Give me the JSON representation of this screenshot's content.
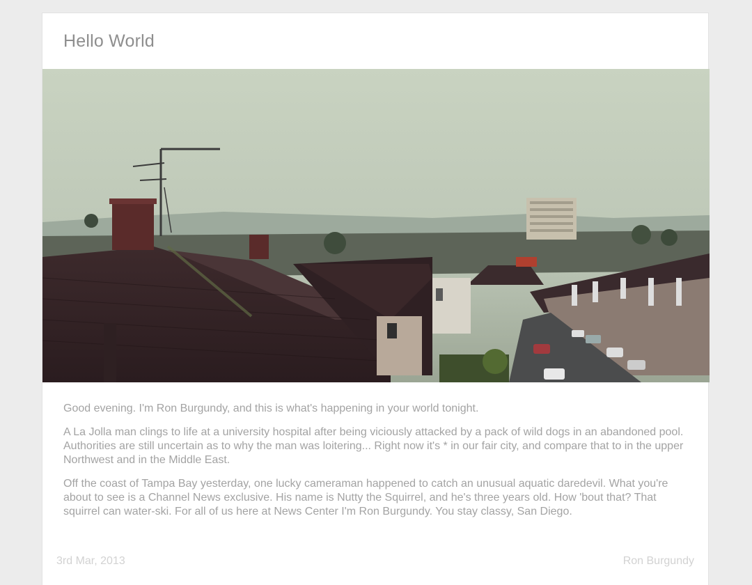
{
  "post": {
    "title": "Hello World",
    "paragraphs": [
      "Good evening. I'm Ron Burgundy, and this is what's happening in your world tonight.",
      "A La Jolla man clings to life at a university hospital after being viciously attacked by a pack of wild dogs in an abandoned pool. Authorities are still uncertain as to why the man was loitering... Right now it's * in our fair city, and compare that to in the upper Northwest and in the Middle East.",
      "Off the coast of Tampa Bay yesterday, one lucky cameraman happened to catch an unusual aquatic daredevil. What you're about to see is a Channel News exclusive. His name is Nutty the Squirrel, and he's three years old. How 'bout that? That squirrel can water-ski. For all of us here at News Center I'm Ron Burgundy. You stay classy, San Diego."
    ],
    "date": "3rd Mar, 2013",
    "author": "Ron Burgundy"
  }
}
